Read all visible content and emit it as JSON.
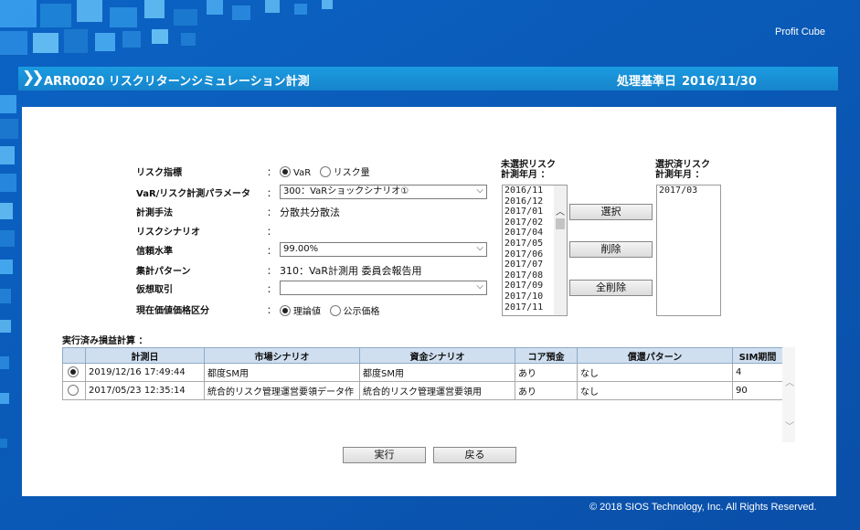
{
  "brand": "Profit Cube",
  "title": {
    "prefix_icon": "double-chevron-right-icon",
    "text": "ARR0020 リスクリターンシミュレーション計測",
    "date_label": "処理基準日",
    "date_value": "2016/11/30"
  },
  "form": {
    "risk_metric": {
      "label": "リスク指標",
      "options": [
        "VaR",
        "リスク量"
      ],
      "selected": "VaR"
    },
    "var_param": {
      "label": "VaR/リスク計測パラメータ",
      "value": "300：VaRショックシナリオ①"
    },
    "method": {
      "label": "計測手法",
      "value": "分散共分散法"
    },
    "scenario": {
      "label": "リスクシナリオ",
      "value": ""
    },
    "confidence": {
      "label": "信頼水準",
      "value": "99.00%"
    },
    "aggregation": {
      "label": "集計パターン",
      "value": "310：VaR計測用 委員会報告用"
    },
    "virtual_trade": {
      "label": "仮想取引",
      "value": ""
    },
    "pv_price": {
      "label": "現在価値価格区分",
      "options": [
        "理論値",
        "公示価格"
      ],
      "selected": "理論値"
    },
    "colon": "："
  },
  "unselected_list": {
    "label_line1": "未選択リスク",
    "label_line2": "計測年月 ：",
    "items": [
      "2016/11",
      "2016/12",
      "2017/01",
      "2017/02",
      "2017/04",
      "2017/05",
      "2017/06",
      "2017/07",
      "2017/08",
      "2017/09",
      "2017/10",
      "2017/11"
    ]
  },
  "selected_list": {
    "label_line1": "選択済リスク",
    "label_line2": "計測年月 ：",
    "items": [
      "2017/03"
    ]
  },
  "buttons": {
    "select": "選択",
    "remove": "削除",
    "remove_all": "全削除",
    "execute": "実行",
    "back": "戻る"
  },
  "results": {
    "title": "実行済み損益計算 ：",
    "columns": [
      "",
      "計測日",
      "市場シナリオ",
      "資金シナリオ",
      "コア預金",
      "償還パターン",
      "SIM期間"
    ],
    "rows": [
      {
        "selected": true,
        "date": "2019/12/16 17:49:44",
        "market": "都度SM用",
        "funding": "都度SM用",
        "core": "あり",
        "redemption": "なし",
        "sim": "4"
      },
      {
        "selected": false,
        "date": "2017/05/23 12:35:14",
        "market": "統合的リスク管理運営要領データ作",
        "funding": "統合的リスク管理運営要領用",
        "core": "あり",
        "redemption": "なし",
        "sim": "90"
      }
    ]
  },
  "copyright": "© 2018 SIOS Technology, Inc. All Rights Reserved.",
  "colors": {
    "background": "#0a57b5",
    "titlebar": "#1684cc",
    "table_header": "#cfdff0"
  }
}
